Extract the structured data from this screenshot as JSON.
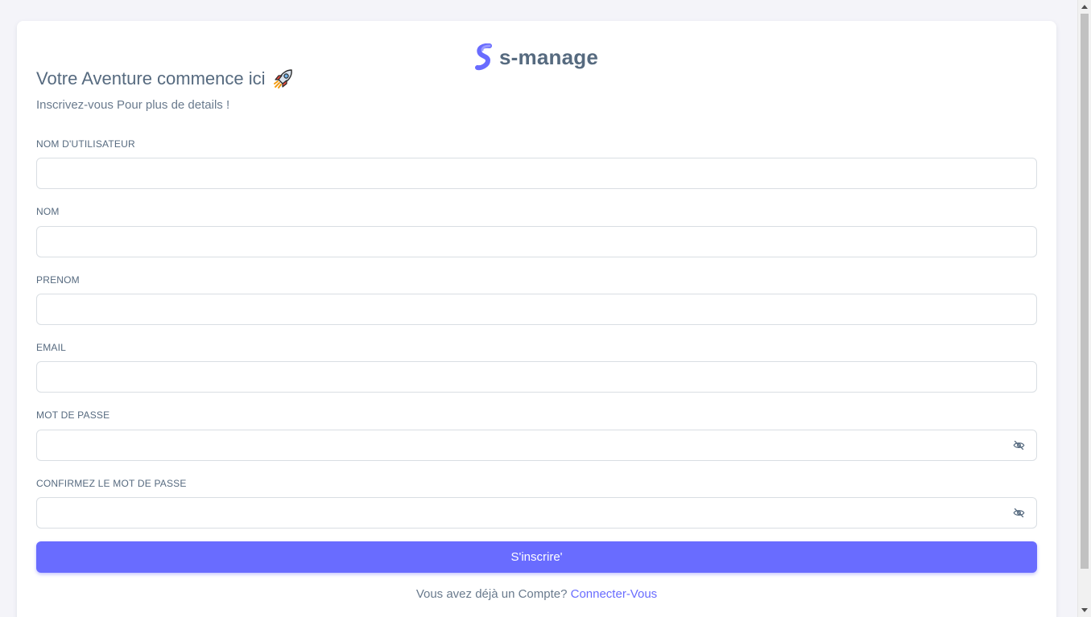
{
  "brand": {
    "name": "s-manage",
    "logo_icon": "s-logo-icon",
    "accent_color": "#696cff"
  },
  "header": {
    "title": "Votre Aventure commence ici",
    "title_icon": "rocket-icon",
    "subtitle": "Inscrivez-vous Pour plus de details !"
  },
  "form": {
    "fields": [
      {
        "label": "NOM D'UTILISATEUR",
        "value": "",
        "placeholder": ""
      },
      {
        "label": "NOM",
        "value": "",
        "placeholder": ""
      },
      {
        "label": "PRENOM",
        "value": "",
        "placeholder": ""
      },
      {
        "label": "EMAIL",
        "value": "",
        "placeholder": ""
      },
      {
        "label": "MOT DE PASSE",
        "value": "",
        "placeholder": "",
        "toggle_icon": "eye-off-icon"
      },
      {
        "label": "CONFIRMEZ LE MOT DE PASSE",
        "value": "",
        "placeholder": "",
        "toggle_icon": "eye-off-icon"
      }
    ],
    "submit_label": "S'inscrire'"
  },
  "footer": {
    "prompt": "Vous avez déjà un Compte?",
    "link_label": "Connecter-Vous"
  }
}
